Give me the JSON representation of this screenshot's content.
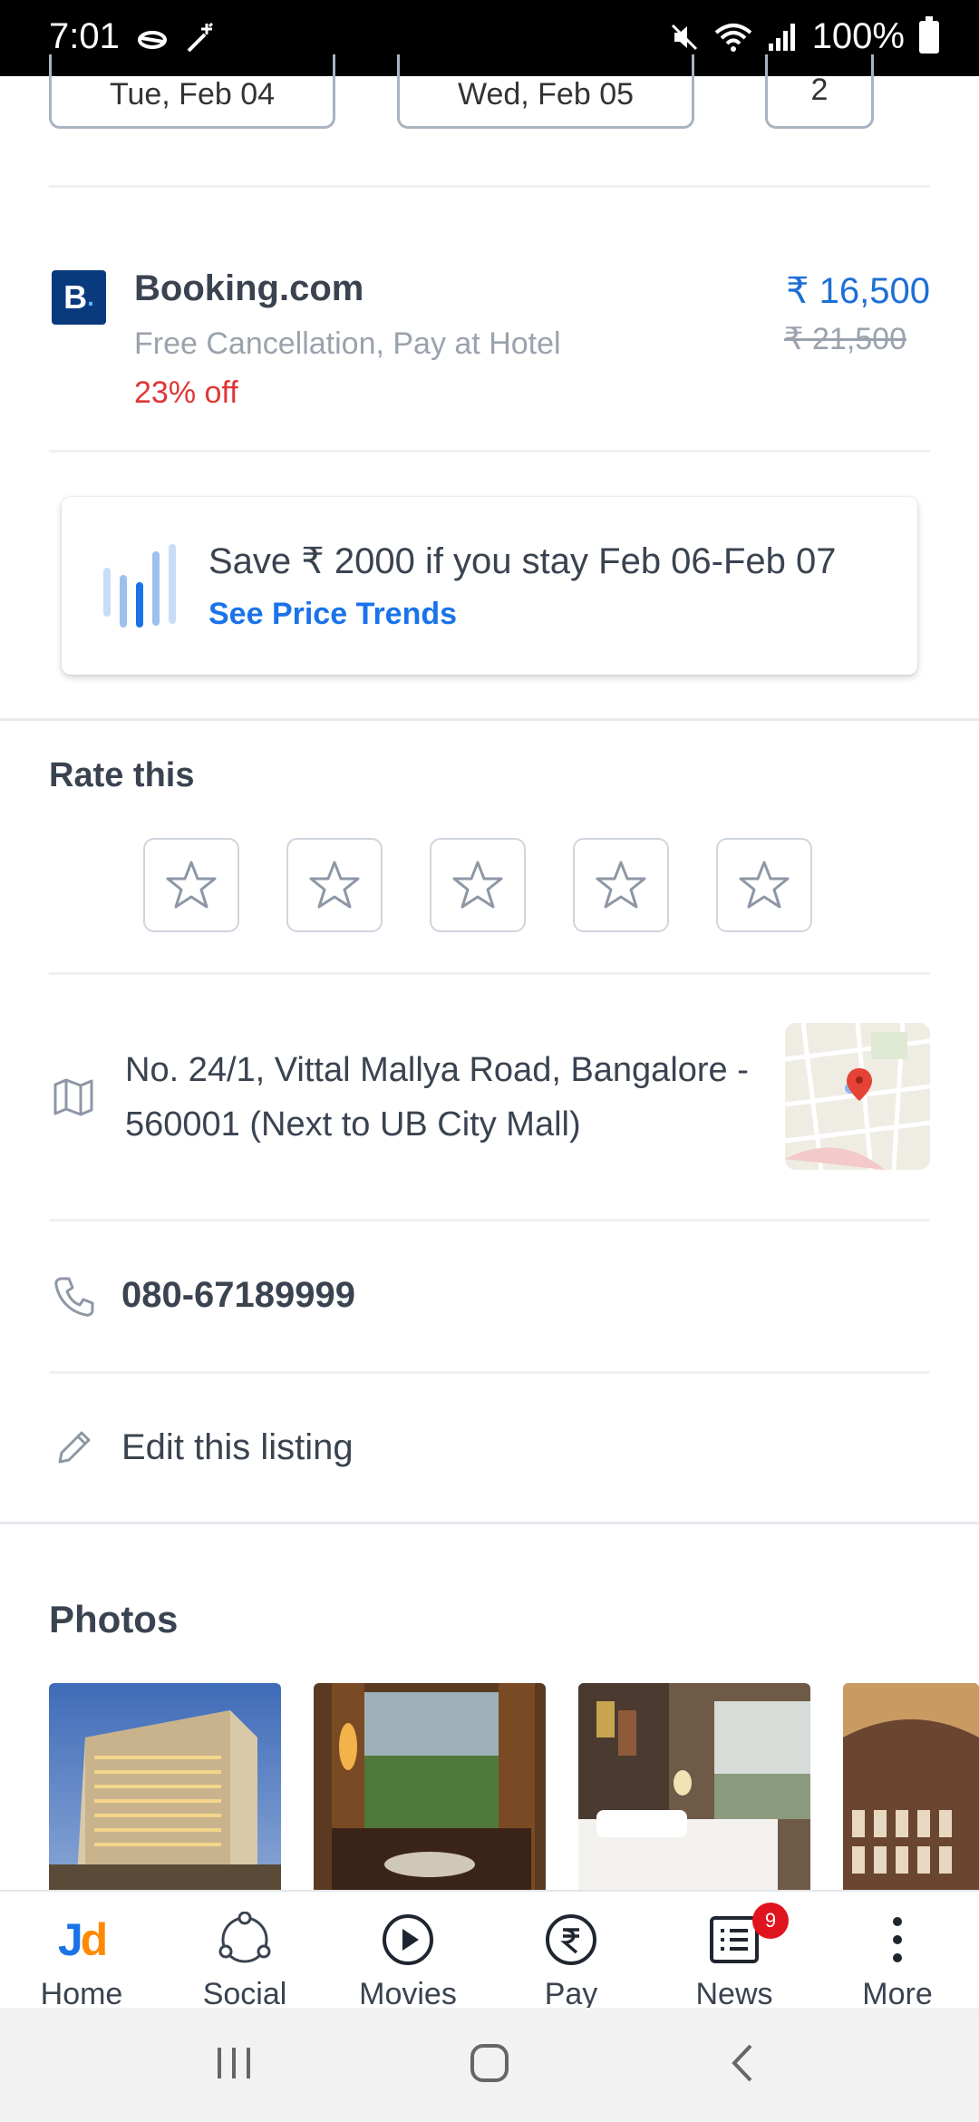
{
  "status_bar": {
    "time": "7:01",
    "battery": "100%"
  },
  "booking_dates": {
    "checkin": "Tue, Feb 04",
    "checkout": "Wed, Feb 05",
    "guests": "2"
  },
  "offer": {
    "provider": "Booking.com",
    "logo_letter": "B",
    "subtitle": "Free Cancellation, Pay at Hotel",
    "discount": "23% off",
    "price": "₹ 16,500",
    "original_price": "₹ 21,500"
  },
  "price_trend": {
    "message": "Save ₹ 2000 if you stay Feb 06-Feb 07",
    "link": "See Price Trends"
  },
  "rating": {
    "title": "Rate this",
    "stars": 5
  },
  "address": {
    "text": "No. 24/1, Vittal Mallya Road, Bangalore - 560001 (Next to UB City Mall)"
  },
  "phone": {
    "number": "080-67189999"
  },
  "edit": {
    "label": "Edit this listing"
  },
  "photos": {
    "title": "Photos"
  },
  "bottom_nav": {
    "home": "Home",
    "social": "Social",
    "movies": "Movies",
    "pay": "Pay",
    "news": "News",
    "news_badge": "9",
    "more": "More"
  },
  "colors": {
    "accent": "#1a73e8",
    "discount": "#e03636",
    "badge": "#e0141e"
  }
}
